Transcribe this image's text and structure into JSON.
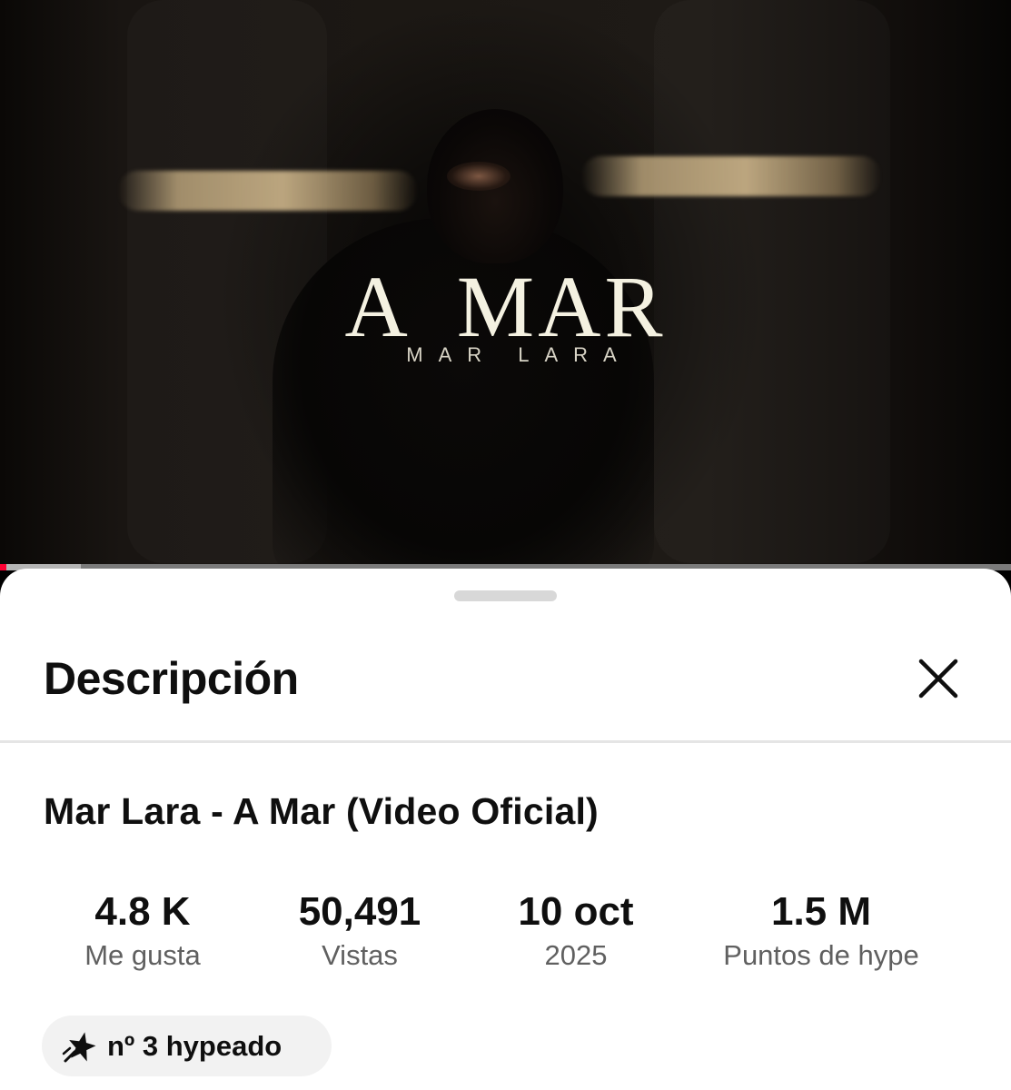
{
  "video": {
    "overlay_title_word1": "A",
    "overlay_title_word2": "MAR",
    "overlay_artist": "MAR LARA",
    "progress_played_fraction": 0.006,
    "progress_buffered_fraction": 0.08,
    "colors": {
      "progress_played": "#ff0033",
      "title_text": "#f4f1e1"
    }
  },
  "description_sheet": {
    "heading": "Descripción",
    "close_icon": "close-icon",
    "video_title": "Mar Lara - A Mar (Video Oficial)",
    "stats": [
      {
        "value": "4.8 K",
        "label": "Me gusta"
      },
      {
        "value": "50,491",
        "label": "Vistas"
      },
      {
        "value": "10 oct",
        "label": "2025"
      },
      {
        "value": "1.5 M",
        "label": "Puntos de hype"
      }
    ],
    "hype_chip": {
      "icon": "hype-star-icon",
      "label": "nº 3 hypeado"
    }
  }
}
